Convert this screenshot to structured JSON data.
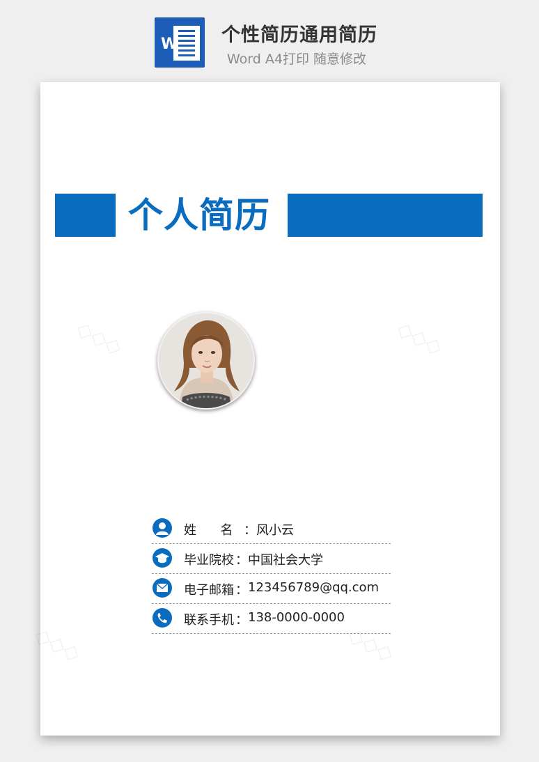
{
  "header": {
    "icon": "word-icon",
    "icon_letter": "W",
    "title": "个性简历通用简历",
    "subtitle": "Word A4打印 随意修改"
  },
  "resume": {
    "title": "个人简历",
    "accent_color": "#0a6cbf",
    "photo": "avatar",
    "info": [
      {
        "icon": "user-icon",
        "label": "姓      名",
        "value": "风小云"
      },
      {
        "icon": "graduation-cap-icon",
        "label": "毕业院校",
        "value": "中国社会大学"
      },
      {
        "icon": "mail-icon",
        "label": "电子邮箱",
        "value": "123456789@qq.com"
      },
      {
        "icon": "phone-icon",
        "label": "联系手机",
        "value": "138-0000-0000"
      }
    ],
    "separator": "："
  }
}
